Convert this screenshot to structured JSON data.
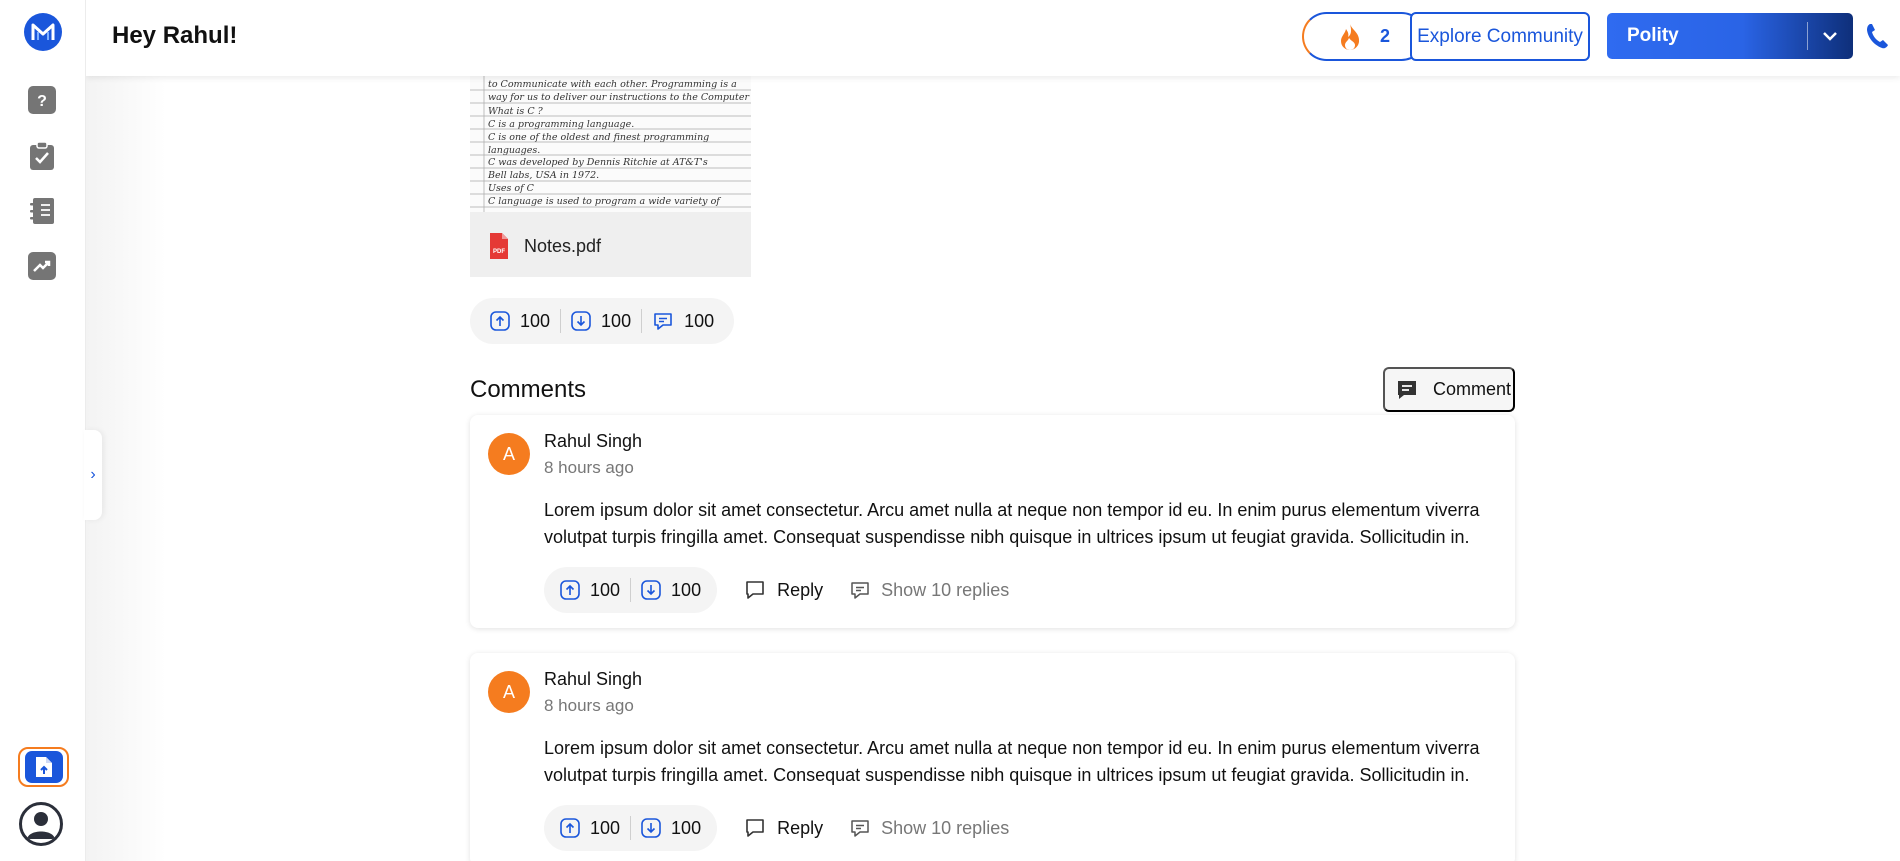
{
  "header": {
    "greeting": "Hey Rahul!",
    "streak_count": "2",
    "explore_label": "Explore Community",
    "subject_selected": "Polity"
  },
  "post": {
    "attachment_name": "Notes.pdf",
    "attachment_badge": "PDF",
    "notes_lines": [
      "to Communicate with each other. Programming is a",
      "way for us to deliver our instructions to the Computer",
      "What is C ?",
      "C is a programming language.",
      "C is one of the oldest and finest programming",
      "languages.",
      "C was developed by Dennis Ritchie at AT&T's",
      "Bell labs, USA in 1972.",
      "Uses of C",
      "C language is used to program a wide variety of"
    ],
    "upvotes": "100",
    "downvotes": "100",
    "comments_count": "100"
  },
  "comments_section": {
    "title": "Comments",
    "comment_button_label": "Comment",
    "items": [
      {
        "avatar_letter": "A",
        "author": "Rahul Singh",
        "time": "8 hours ago",
        "body": "Lorem ipsum dolor sit amet consectetur. Arcu amet nulla at neque non tempor id eu. In enim purus elementum viverra volutpat turpis fringilla amet. Consequat suspendisse nibh quisque in ultrices ipsum ut feugiat gravida. Sollicitudin in.",
        "upvotes": "100",
        "downvotes": "100",
        "reply_label": "Reply",
        "show_replies_label": "Show 10 replies"
      },
      {
        "avatar_letter": "A",
        "author": "Rahul Singh",
        "time": "8 hours ago",
        "body": "Lorem ipsum dolor sit amet consectetur. Arcu amet nulla at neque non tempor id eu. In enim purus elementum viverra volutpat turpis fringilla amet. Consequat suspendisse nibh quisque in ultrices ipsum ut feugiat gravida. Sollicitudin in.",
        "upvotes": "100",
        "downvotes": "100",
        "reply_label": "Reply",
        "show_replies_label": "Show 10 replies"
      }
    ]
  },
  "icons": {
    "logo": "m-logo-icon",
    "sidebar": [
      "question-icon",
      "clipboard-check-icon",
      "notebook-icon",
      "trending-chart-icon"
    ],
    "collapse": "chevron-right-icon",
    "upload": "upload-document-icon",
    "profile": "user-avatar-icon",
    "streak": "fire-icon",
    "subject_chevron": "chevron-down-icon",
    "phone": "phone-icon"
  },
  "colors": {
    "primary": "#1a56db",
    "accent_orange": "#f57c1f",
    "icon_gray": "#757575",
    "muted_text": "#777777"
  }
}
